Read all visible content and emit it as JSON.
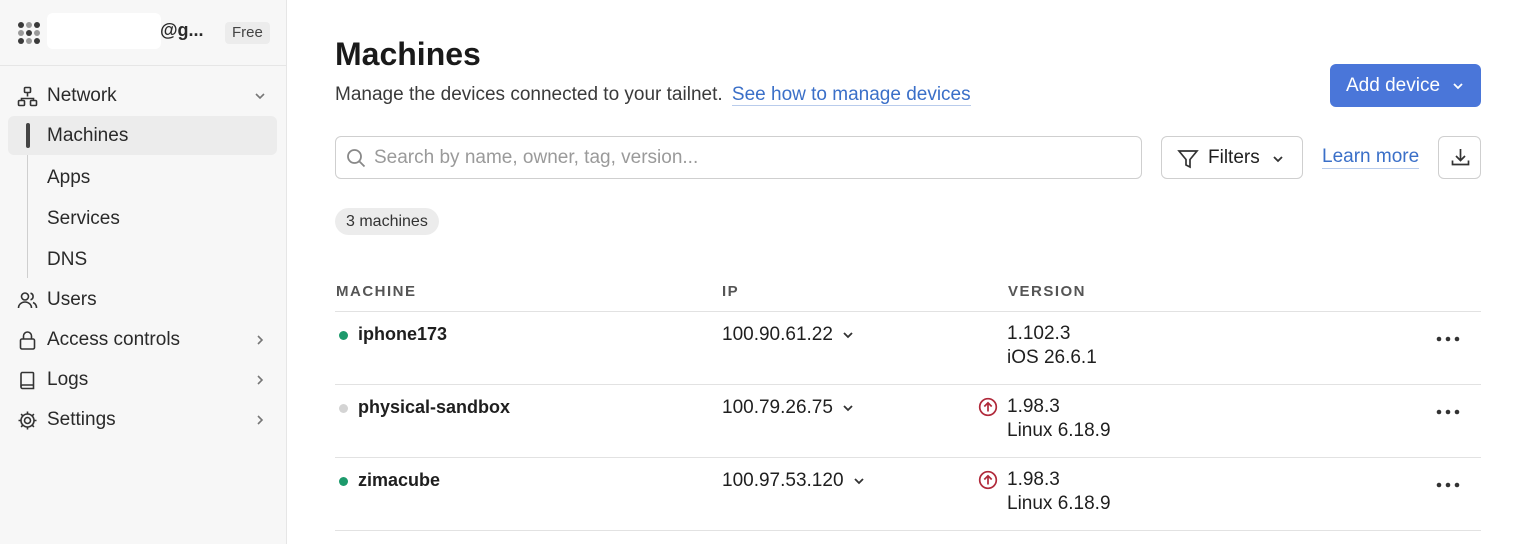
{
  "account": {
    "name_suffix": "@g...",
    "plan": "Free"
  },
  "nav": {
    "network": "Network",
    "sub": [
      "Machines",
      "Apps",
      "Services",
      "DNS"
    ],
    "users": "Users",
    "access_controls": "Access controls",
    "logs": "Logs",
    "settings": "Settings"
  },
  "page": {
    "title": "Machines",
    "subtitle": "Manage the devices connected to your tailnet.",
    "subtitle_link": "See how to manage devices",
    "add_device": "Add device",
    "search_placeholder": "Search by name, owner, tag, version...",
    "filters": "Filters",
    "learn_more": "Learn more",
    "count": "3 machines"
  },
  "table": {
    "columns": [
      "MACHINE",
      "IP",
      "VERSION"
    ],
    "rows": [
      {
        "name": "iphone173",
        "status": "online",
        "ip": "100.90.61.22",
        "version": "1.102.3",
        "os": "iOS 26.6.1",
        "update_available": false
      },
      {
        "name": "physical-sandbox",
        "status": "offline",
        "ip": "100.79.26.75",
        "version": "1.98.3",
        "os": "Linux 6.18.9",
        "update_available": true
      },
      {
        "name": "zimacube",
        "status": "online",
        "ip": "100.97.53.120",
        "version": "1.98.3",
        "os": "Linux 6.18.9",
        "update_available": true
      }
    ]
  },
  "colors": {
    "accent": "#4a76d9",
    "online": "#1d9a6c",
    "offline": "#d4d4d4",
    "update": "#b0293a"
  }
}
